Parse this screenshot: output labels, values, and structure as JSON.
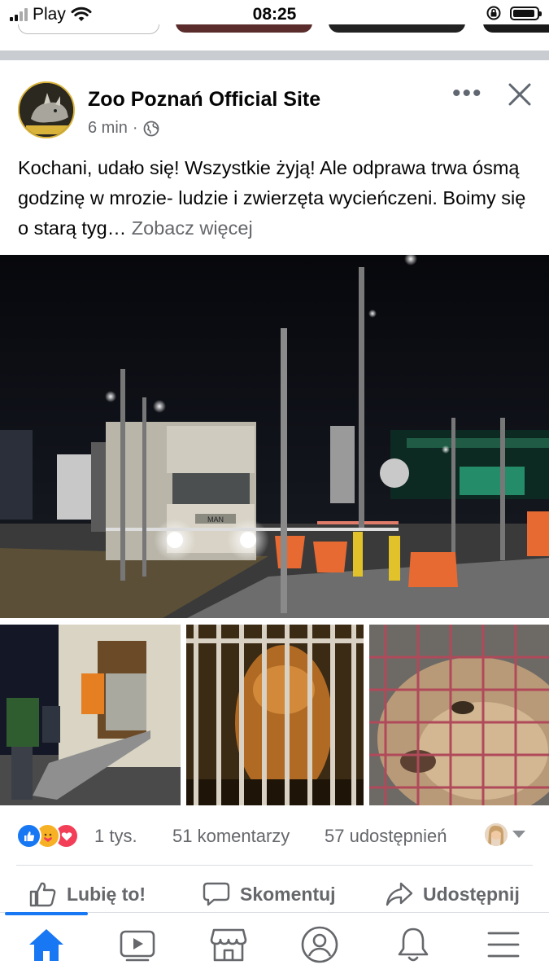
{
  "status_bar": {
    "carrier": "Play",
    "time": "08:25"
  },
  "post": {
    "page_name": "Zoo Poznań Official Site",
    "time_ago": "6 min",
    "separator": "·",
    "avatar_text_top": "ZOO",
    "avatar_text_bottom": "POZNAŃ",
    "text": "Kochani, udało się! Wszystkie żyją! Ale odprawa trwa ósmą godzinę w mrozie- ludzie i zwierzęta wycieńczeni. Boimy się o starą tyg…",
    "see_more": "Zobacz więcej",
    "truck_badge": "MAN"
  },
  "engagement": {
    "reaction_count": "1 tys.",
    "comments": "51 komentarzy",
    "shares": "57 udostępnień"
  },
  "actions": {
    "like": "Lubię to!",
    "comment": "Skomentuj",
    "share": "Udostępnij"
  },
  "icons": [
    "wifi-icon",
    "rotation-lock-icon",
    "battery-icon",
    "more-icon",
    "close-icon",
    "globe-icon",
    "like-reaction-icon",
    "care-reaction-icon",
    "love-reaction-icon",
    "thumbs-up-icon",
    "comment-icon",
    "share-icon",
    "home-icon",
    "video-icon",
    "marketplace-icon",
    "profile-icon",
    "bell-icon",
    "menu-icon"
  ],
  "colors": {
    "accent": "#1877f2",
    "secondary_text": "#65676b",
    "love": "#f33e58",
    "care": "#f7b125"
  }
}
